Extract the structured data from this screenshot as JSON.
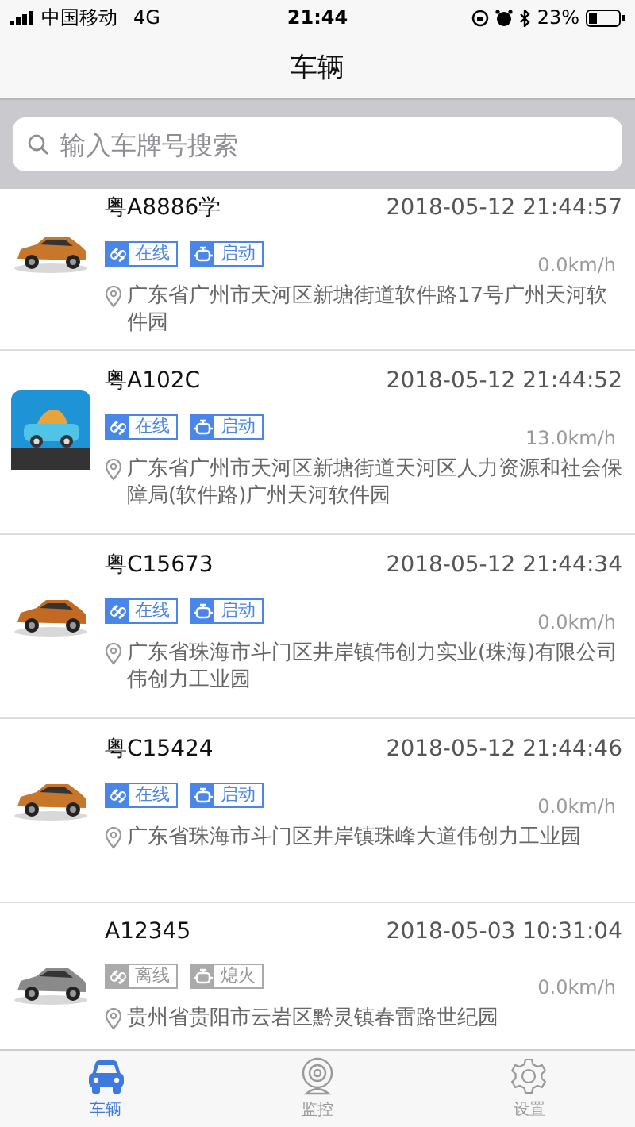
{
  "status_bar": {
    "carrier": "中国移动",
    "network": "4G",
    "time": "21:44",
    "battery": "23%"
  },
  "nav": {
    "title": "车辆"
  },
  "search": {
    "placeholder": "输入车牌号搜索"
  },
  "vehicles": [
    {
      "plate": "粤A8886学",
      "time": "2018-05-12 21:44:57",
      "speed": "0.0km/h",
      "address": "广东省广州市天河区新塘街道软件路17号广州天河软件园",
      "image": {
        "kind": "picture"
      },
      "tags": [
        {
          "kind": "link",
          "text": "在线",
          "active": true
        },
        {
          "kind": "engine",
          "text": "启动",
          "active": true
        }
      ]
    },
    {
      "plate": "粤A102C",
      "time": "2018-05-12 21:44:52",
      "speed": "13.0km/h",
      "address": "广东省广州市天河区新塘街道天河区人力资源和社会保障局(软件路)广州天河软件园",
      "image": {
        "kind": "picture"
      },
      "tags": [
        {
          "kind": "link",
          "text": "在线",
          "active": true
        },
        {
          "kind": "engine",
          "text": "启动",
          "active": true
        }
      ]
    },
    {
      "plate": "粤C15673",
      "time": "2018-05-12 21:44:34",
      "speed": "0.0km/h",
      "address": "广东省珠海市斗门区井岸镇伟创力实业(珠海)有限公司伟创力工业园",
      "image": {
        "kind": "picture"
      },
      "tags": [
        {
          "kind": "link",
          "text": "在线",
          "active": true
        },
        {
          "kind": "engine",
          "text": "启动",
          "active": true
        }
      ]
    },
    {
      "plate": "粤C15424",
      "time": "2018-05-12 21:44:46",
      "speed": "0.0km/h",
      "address": "广东省珠海市斗门区井岸镇珠峰大道伟创力工业园",
      "image": {
        "kind": "picture"
      },
      "tags": [
        {
          "kind": "link",
          "text": "在线",
          "active": true
        },
        {
          "kind": "engine",
          "text": "启动",
          "active": true
        }
      ]
    },
    {
      "plate": "A12345",
      "time": "2018-05-03 10:31:04",
      "speed": "0.0km/h",
      "address": "贵州省贵阳市云岩区黔灵镇春雷路世纪园",
      "image": {
        "kind": "picture"
      },
      "tags": [
        {
          "kind": "link",
          "text": "离线",
          "active": false
        },
        {
          "kind": "engine",
          "text": "熄火",
          "active": false
        }
      ]
    }
  ],
  "tab_bar": [
    {
      "kind": "car",
      "label": "车辆",
      "selected": true
    },
    {
      "kind": "camera",
      "label": "监控",
      "selected": false
    },
    {
      "kind": "settings",
      "label": "设置",
      "selected": false
    }
  ]
}
